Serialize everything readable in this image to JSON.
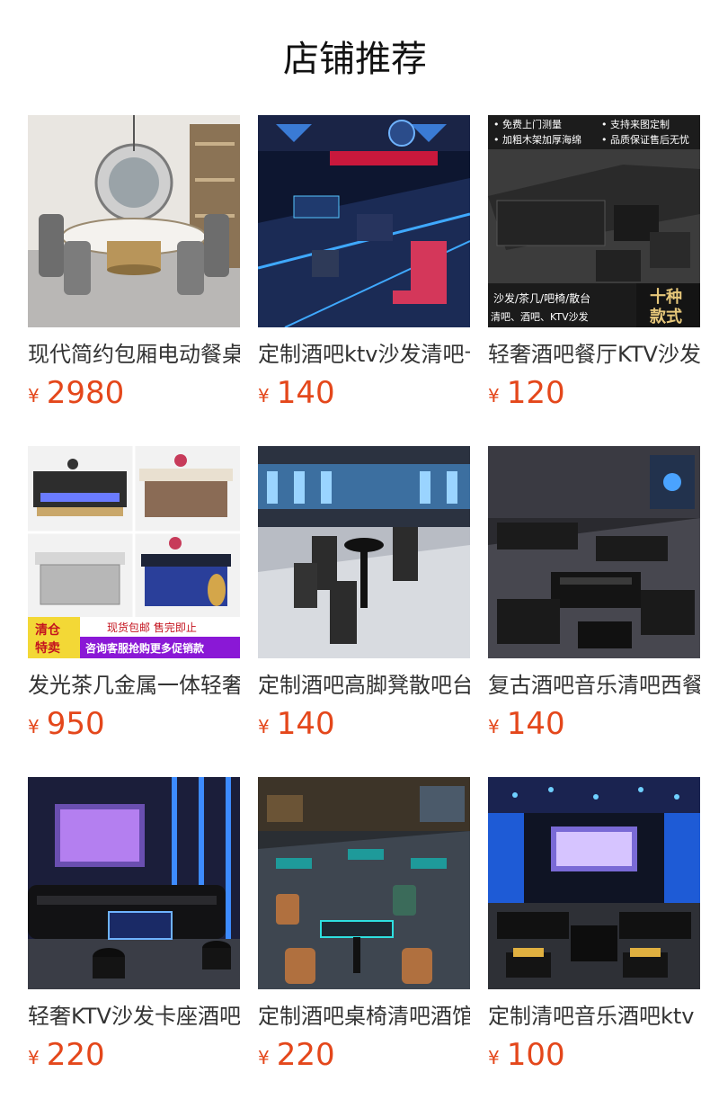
{
  "section": {
    "title": "店铺推荐",
    "currency_symbol": "¥"
  },
  "products": [
    {
      "name": "现代简约包厢电动餐桌",
      "price": "2980",
      "image_texts": []
    },
    {
      "name": "定制酒吧ktv沙发清吧卡座",
      "price": "140",
      "image_texts": []
    },
    {
      "name": "轻奢酒吧餐厅KTV沙发",
      "price": "120",
      "image_texts": [
        "• 免费上门测量",
        "• 支持来图定制",
        "• 加粗木架加厚海绵",
        "• 品质保证售后无忧",
        "沙发/茶几/吧椅/散台",
        "清吧、酒吧、KTV沙发",
        "十种",
        "款式"
      ]
    },
    {
      "name": "发光茶几金属一体轻奢",
      "price": "950",
      "image_texts": [
        "清仓",
        "特卖",
        "现货包邮 售完即止",
        "咨询客服抢购更多促销款"
      ]
    },
    {
      "name": "定制酒吧高脚凳散吧台",
      "price": "140",
      "image_texts": []
    },
    {
      "name": "复古酒吧音乐清吧西餐",
      "price": "140",
      "image_texts": []
    },
    {
      "name": "轻奢KTV沙发卡座酒吧",
      "price": "220",
      "image_texts": []
    },
    {
      "name": "定制酒吧桌椅清吧酒馆",
      "price": "220",
      "image_texts": []
    },
    {
      "name": "定制清吧音乐酒吧ktv",
      "price": "100",
      "image_texts": []
    }
  ]
}
